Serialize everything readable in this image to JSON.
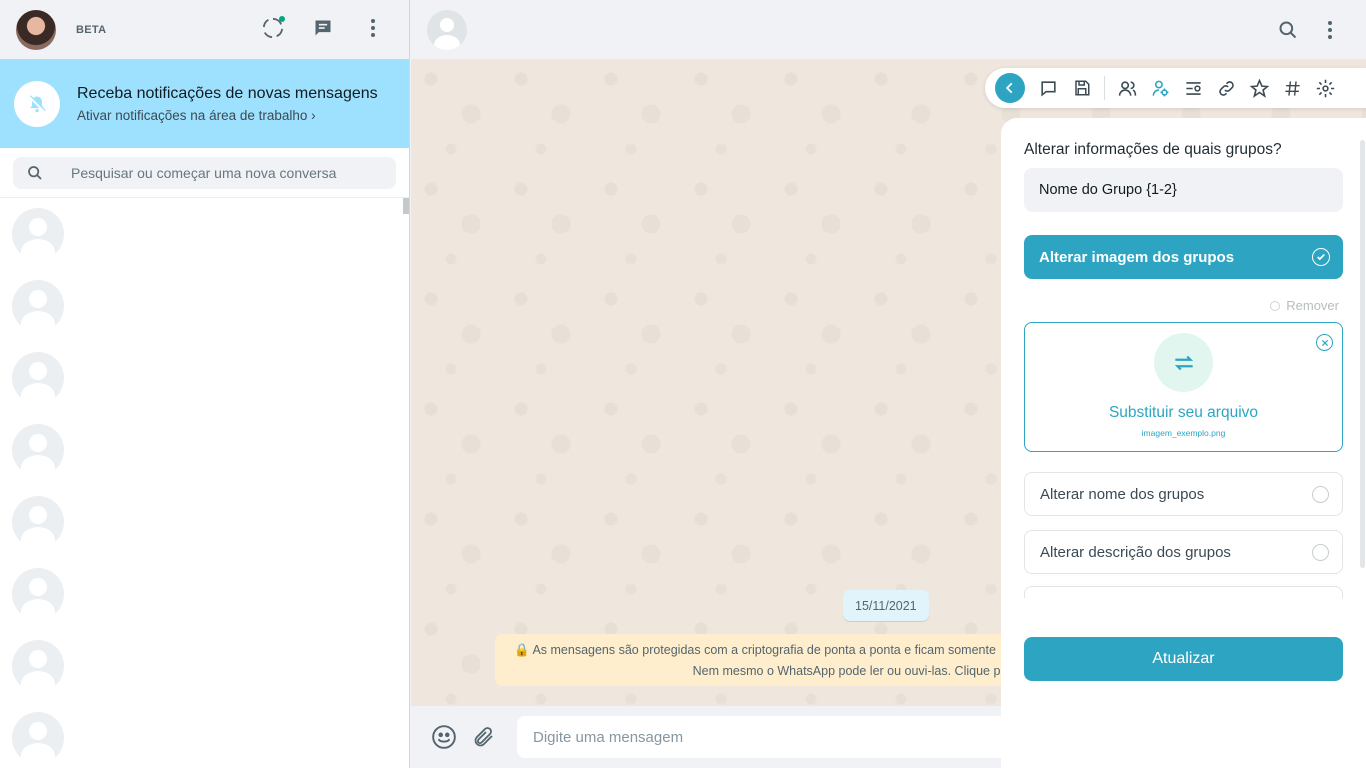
{
  "left_header": {
    "badge": "BETA"
  },
  "notification": {
    "title": "Receba notificações de novas mensagens",
    "subtitle": "Ativar notificações na área de trabalho",
    "chevron": "›"
  },
  "search": {
    "placeholder": "Pesquisar ou começar uma nova conversa"
  },
  "chat_list": {
    "placeholder_count": 8
  },
  "conversation": {
    "date_chip": "15/11/2021",
    "crypto_line1": "As mensagens são protegidas com a criptografia de ponta a ponta e ficam somente",
    "crypto_line2": "Nem mesmo o WhatsApp pode ler ou ouvi-las. Clique pa"
  },
  "composer": {
    "placeholder": "Digite uma mensagem"
  },
  "toolbar": {
    "icons": [
      "back-icon",
      "chat-icon",
      "save-icon",
      "users-icon",
      "user-gear-icon",
      "list-settings-icon",
      "link-icon",
      "star-icon",
      "hash-icon",
      "settings-icon"
    ],
    "active": "user-gear-icon"
  },
  "panel": {
    "question": "Alterar informações de quais grupos?",
    "group_name_value": "Nome do Grupo {1-2}",
    "option_image": "Alterar imagem dos grupos",
    "remove_label": "Remover",
    "upload_title": "Substituir seu arquivo",
    "upload_filename": "imagem_exemplo.png",
    "option_name": "Alterar nome dos grupos",
    "option_description": "Alterar descrição dos grupos",
    "update_button": "Atualizar"
  },
  "colors": {
    "accent": "#2da5c2",
    "notification_bg": "#9de1fe",
    "wallpaper": "#efe7de"
  }
}
